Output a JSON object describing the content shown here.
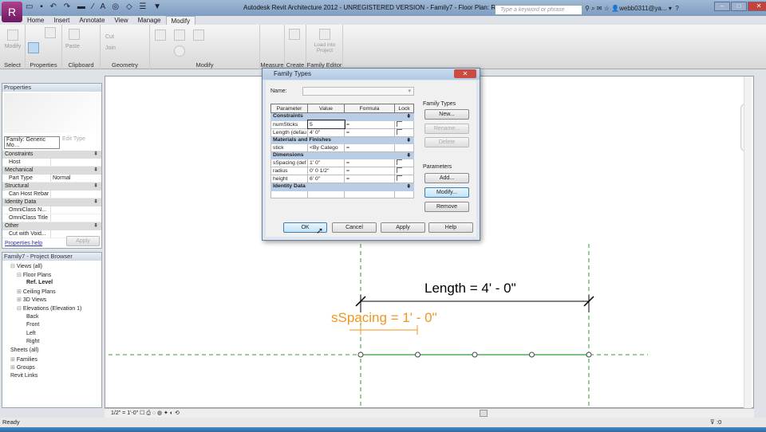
{
  "titlebar": {
    "title": "Autodesk Revit Architecture 2012 - UNREGISTERED VERSION -   Family7 - Floor Plan: Ref. Level",
    "search_placeholder": "Type a keyword or phrase",
    "user": "webb0311@ya...",
    "help": "?"
  },
  "tabs": [
    "Home",
    "Insert",
    "Annotate",
    "View",
    "Manage",
    "Modify"
  ],
  "ribbon": {
    "groups": [
      "Select",
      "Properties",
      "Clipboard",
      "Geometry",
      "Modify",
      "Measure",
      "Create",
      "Family Editor"
    ],
    "modify_label": "Modify",
    "paste_label": "Paste",
    "cut_label": "Cut",
    "join_label": "Join",
    "load_label": "Load into Project"
  },
  "properties": {
    "title": "Properties",
    "family": "Family: Generic Mo…",
    "edit_type": "Edit Type",
    "rows": [
      {
        "type": "section",
        "label": "Constraints"
      },
      {
        "type": "row",
        "label": "Host",
        "value": ""
      },
      {
        "type": "section",
        "label": "Mechanical"
      },
      {
        "type": "row",
        "label": "Part Type",
        "value": "Normal"
      },
      {
        "type": "section",
        "label": "Structural"
      },
      {
        "type": "row",
        "label": "Can Host Rebar",
        "value": ""
      },
      {
        "type": "section",
        "label": "Identity Data"
      },
      {
        "type": "row",
        "label": "OmniClass N...",
        "value": ""
      },
      {
        "type": "row",
        "label": "OmniClass Title",
        "value": ""
      },
      {
        "type": "section",
        "label": "Other"
      },
      {
        "type": "row",
        "label": "Cut with Void...",
        "value": ""
      }
    ],
    "help": "Properties help",
    "apply": "Apply"
  },
  "browser": {
    "title": "Family7 - Project Browser",
    "items": [
      "Views (all)",
      "Floor Plans",
      "Ref. Level",
      "Ceiling Plans",
      "3D Views",
      "Elevations (Elevation 1)",
      "Back",
      "Front",
      "Left",
      "Right",
      "Sheets (all)",
      "Families",
      "Groups",
      "Revit Links"
    ]
  },
  "dialog": {
    "title": "Family Types",
    "name_label": "Name:",
    "headers": [
      "Parameter",
      "Value",
      "Formula",
      "Lock"
    ],
    "groups": [
      {
        "name": "Constraints",
        "rows": [
          [
            "numSticks",
            "5",
            "="
          ],
          [
            "Length (defau",
            "4'  0\"",
            "="
          ]
        ]
      },
      {
        "name": "Materials and Finishes",
        "rows": [
          [
            "stick",
            "<By Catego",
            "="
          ]
        ]
      },
      {
        "name": "Dimensions",
        "rows": [
          [
            "sSpacing (def",
            "1'  0\"",
            "="
          ],
          [
            "radius",
            "0'  0 1/2\"",
            "="
          ],
          [
            "height",
            "6'  0\"",
            "="
          ]
        ]
      },
      {
        "name": "Identity Data",
        "rows": []
      }
    ],
    "family_types_label": "Family Types",
    "new": "New...",
    "rename": "Rename...",
    "delete": "Delete",
    "parameters_label": "Parameters",
    "add": "Add...",
    "modify": "Modify...",
    "remove": "Remove",
    "ok": "OK",
    "cancel": "Cancel",
    "apply": "Apply",
    "help": "Help"
  },
  "canvas": {
    "length_dim": "Length = 4' - 0\"",
    "spacing_dim": "sSpacing = 1' - 0\"",
    "ref_color": "#2e9e2e",
    "spacing_color": "#f0961e"
  },
  "viewbar": {
    "scale": "1/2\" = 1'-0\""
  },
  "status": {
    "text": "Ready",
    "filter": ":0"
  }
}
